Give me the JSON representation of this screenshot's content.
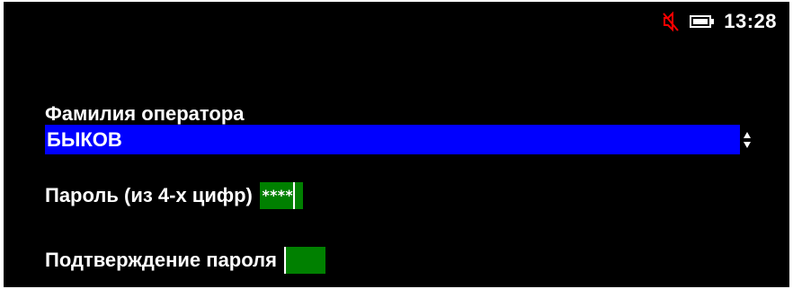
{
  "status": {
    "mute_icon": "speaker-muted-icon",
    "battery_icon": "battery-icon",
    "time": "13:28"
  },
  "operator": {
    "label": "Фамилия оператора",
    "value": "БЫКОВ",
    "selector_icon": "up-down-arrows-icon"
  },
  "password": {
    "label": "Пароль (из 4-х цифр)",
    "mask": "****"
  },
  "confirm": {
    "label": "Подтверждение пароля",
    "mask": ""
  },
  "colors": {
    "background": "#000000",
    "selection": "#0000ff",
    "input_field": "#008000",
    "mute_icon": "#ff0000",
    "text": "#ffffff"
  }
}
